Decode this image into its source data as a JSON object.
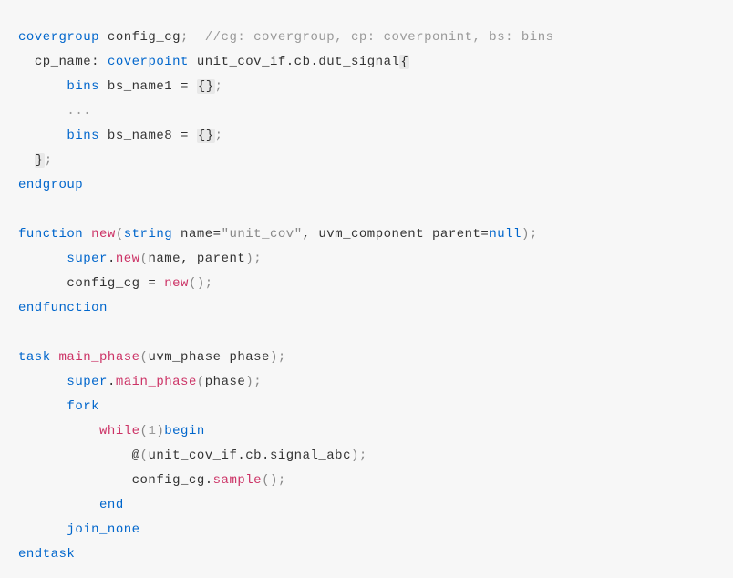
{
  "lines": {
    "l1_kw1": "covergroup",
    "l1_ident1": " config_cg",
    "l1_semi": ";",
    "l1_comment": "  //cg: covergroup, cp: coverponint, bs: bins",
    "l2_indent": "  ",
    "l2_ident1": "cp_name: ",
    "l2_kw1": "coverpoint",
    "l2_ident2": " unit_cov_if.cb.dut_signal",
    "l2_brace": "{",
    "l3_indent": "      ",
    "l3_kw1": "bins",
    "l3_ident1": " bs_name1 = ",
    "l3_braces": "{}",
    "l3_semi": ";",
    "l4_indent": "      ",
    "l4_dots": "...",
    "l5_indent": "      ",
    "l5_kw1": "bins",
    "l5_ident1": " bs_name8 = ",
    "l5_braces": "{}",
    "l5_semi": ";",
    "l6_indent": "  ",
    "l6_brace": "}",
    "l6_semi": ";",
    "l7_kw1": "endgroup",
    "blank1": " ",
    "l9_kw1": "function",
    "l9_kw2": " new",
    "l9_paren1": "(",
    "l9_kw3": "string",
    "l9_ident1": " name=",
    "l9_str": "\"unit_cov\"",
    "l9_comma": ", uvm_component parent=",
    "l9_kw4": "null",
    "l9_paren2": ")",
    "l9_semi": ";",
    "l10_indent": "      ",
    "l10_kw1": "super",
    "l10_dot": ".",
    "l10_kw2": "new",
    "l10_paren1": "(",
    "l10_args": "name, parent",
    "l10_paren2": ")",
    "l10_semi": ";",
    "l11_indent": "      ",
    "l11_ident1": "config_cg = ",
    "l11_kw1": "new",
    "l11_parens": "()",
    "l11_semi": ";",
    "l12_kw1": "endfunction",
    "blank2": " ",
    "l14_kw1": "task",
    "l14_kw2": " main_phase",
    "l14_paren1": "(",
    "l14_args": "uvm_phase phase",
    "l14_paren2": ")",
    "l14_semi": ";",
    "l15_indent": "      ",
    "l15_kw1": "super",
    "l15_dot": ".",
    "l15_kw2": "main_phase",
    "l15_paren1": "(",
    "l15_args": "phase",
    "l15_paren2": ")",
    "l15_semi": ";",
    "l16_indent": "      ",
    "l16_kw1": "fork",
    "l17_indent": "          ",
    "l17_kw1": "while",
    "l17_paren1": "(",
    "l17_num": "1",
    "l17_paren2": ")",
    "l17_kw2": "begin",
    "l18_indent": "              ",
    "l18_at": "@",
    "l18_paren1": "(",
    "l18_ident": "unit_cov_if.cb.signal_abc",
    "l18_paren2": ")",
    "l18_semi": ";",
    "l19_indent": "              ",
    "l19_ident": "config_cg.",
    "l19_kw1": "sample",
    "l19_parens": "()",
    "l19_semi": ";",
    "l20_indent": "          ",
    "l20_kw1": "end",
    "l21_indent": "      ",
    "l21_kw1": "join_none",
    "l22_kw1": "endtask"
  }
}
